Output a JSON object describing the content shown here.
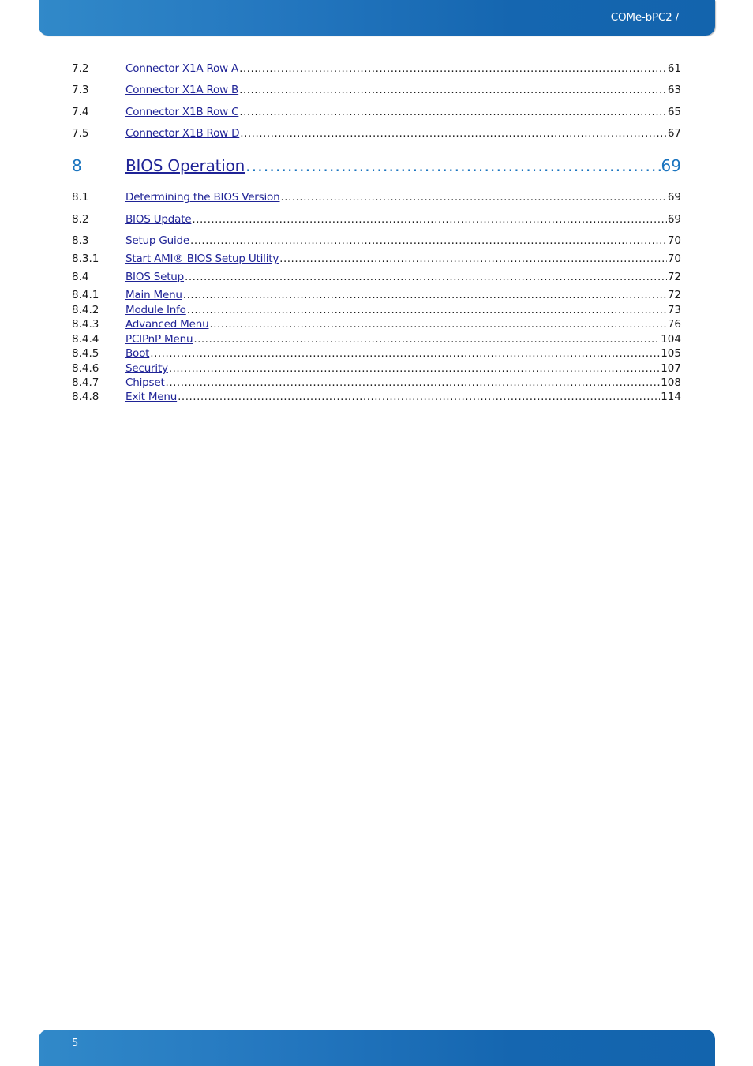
{
  "header": {
    "title": "COMe-bPC2 /"
  },
  "footer": {
    "page_number": "5"
  },
  "toc": {
    "entries": [
      {
        "num": "7.2",
        "title": "Connector X1A Row A",
        "page": "61",
        "level": "section"
      },
      {
        "num": "7.3",
        "title": "Connector X1A Row B",
        "page": "63",
        "level": "section"
      },
      {
        "num": "7.4",
        "title": "Connector X1B Row C",
        "page": "65",
        "level": "section"
      },
      {
        "num": "7.5",
        "title": "Connector X1B Row D",
        "page": "67",
        "level": "section"
      },
      {
        "num": "8",
        "title": "BIOS Operation",
        "page": "69",
        "level": "chapter"
      },
      {
        "num": "8.1",
        "title": "Determining the BIOS Version",
        "page": "69",
        "level": "section"
      },
      {
        "num": "8.2",
        "title": "BIOS Update",
        "page": "69",
        "level": "section"
      },
      {
        "num": "8.3",
        "title": "Setup Guide",
        "page": "70",
        "level": "section"
      },
      {
        "num": "8.3.1",
        "title": "Start AMI® BIOS Setup Utility",
        "page": "70",
        "level": "subsection"
      },
      {
        "num": "8.4",
        "title": "BIOS Setup",
        "page": "72",
        "level": "section"
      },
      {
        "num": "8.4.1",
        "title": "Main Menu",
        "page": "72",
        "level": "subsection"
      },
      {
        "num": "8.4.2",
        "title": "Module Info",
        "page": "73",
        "level": "subsection"
      },
      {
        "num": "8.4.3",
        "title": "Advanced Menu",
        "page": "76",
        "level": "subsection"
      },
      {
        "num": "8.4.4",
        "title": "PCIPnP Menu",
        "page": "104",
        "level": "subsection"
      },
      {
        "num": "8.4.5",
        "title": "Boot",
        "page": "105",
        "level": "subsection"
      },
      {
        "num": "8.4.6",
        "title": "Security",
        "page": "107",
        "level": "subsection"
      },
      {
        "num": "8.4.7",
        "title": "Chipset",
        "page": "108",
        "level": "subsection"
      },
      {
        "num": "8.4.8",
        "title": "Exit Menu",
        "page": "114",
        "level": "subsection"
      }
    ]
  },
  "colors": {
    "brand_blue": "#1a74bf",
    "link": "#1f2396",
    "text": "#1a1a1a"
  }
}
